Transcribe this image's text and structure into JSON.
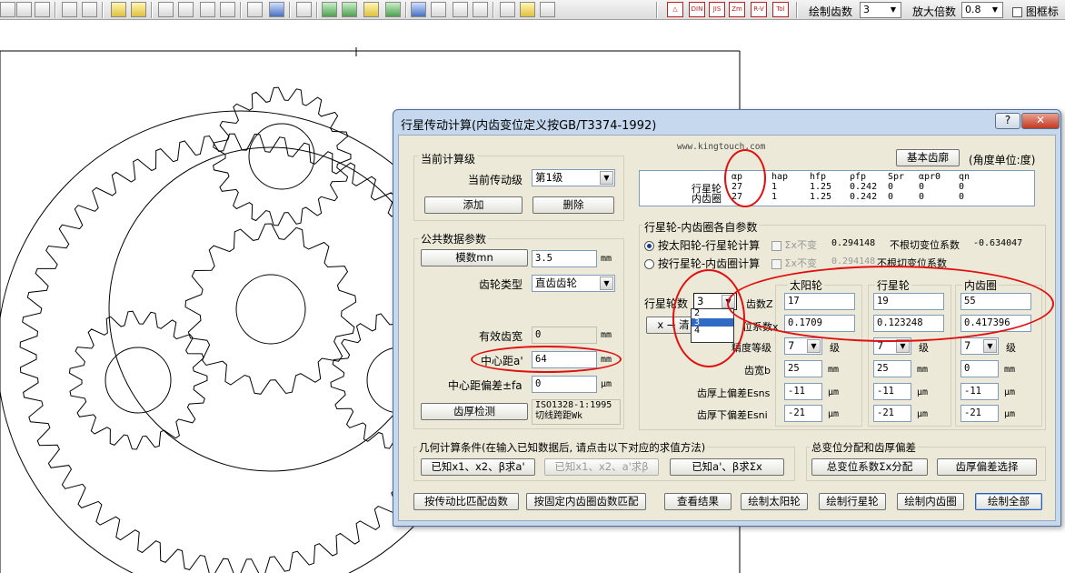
{
  "toolbar": {
    "teeth_label": "绘制齿数",
    "teeth_value": "3",
    "scale_label": "放大倍数",
    "scale_value": "0.8",
    "frame_label": "图框标",
    "icons": [
      "print-icon",
      "preview-icon",
      "copy-icon",
      "page-icon",
      "edit-icon",
      "zoom-in-icon",
      "zoom-out-icon",
      "zoom-fit-icon",
      "zoom-window-icon",
      "list-icon",
      "chart-icon",
      "window-icon",
      "save-icon",
      "open-icon",
      "export-icon",
      "import-icon",
      "display-icon",
      "tool-icon",
      "gear-icon",
      "help-cursor-icon",
      "info-icon",
      "doc-icon"
    ],
    "red_buttons": [
      "",
      "DIN",
      "JIS",
      "Zm",
      "R-V",
      "Tol"
    ]
  },
  "dialog": {
    "title": "行星传动计算(内齿变位定义按GB/T3374-1992)",
    "help_btn": "?",
    "close_btn": "✕",
    "watermark": "www.kingtouch.com",
    "current_stage": {
      "group_label": "当前计算级",
      "stage_label": "当前传动级",
      "stage_value": "第1级",
      "add_btn": "添加",
      "delete_btn": "删除"
    },
    "basic_rack_btn": "基本齿廓",
    "angle_unit": "(角度单位:度)",
    "rack_table": {
      "headers": [
        "αp",
        "hap",
        "hfp",
        "ρfp",
        "Spr",
        "αpr0",
        "qn"
      ],
      "rows": [
        {
          "name": "行星轮",
          "values": [
            "27",
            "1",
            "1.25",
            "0.242",
            "0",
            "0",
            "0"
          ]
        },
        {
          "name": "内齿圈",
          "values": [
            "27",
            "1",
            "1.25",
            "0.242",
            "0",
            "0",
            "0"
          ]
        }
      ]
    },
    "common": {
      "group_label": "公共数据参数",
      "module_btn": "模数mn",
      "module_value": "3.5",
      "module_unit": "mm",
      "gear_type_label": "齿轮类型",
      "gear_type_value": "直齿齿轮",
      "eff_width_label": "有效齿宽",
      "eff_width_value": "0",
      "eff_width_unit": "mm",
      "center_dist_label": "中心距a'",
      "center_dist_value": "64",
      "center_dist_unit": "mm",
      "center_dev_label": "中心距偏差±fa",
      "center_dev_value": "0",
      "center_dev_unit": "μm",
      "thickness_btn": "齿厚检测",
      "thickness_value_1": "ISO1328-1:1995",
      "thickness_value_2": "切线跨距Wk"
    },
    "planet": {
      "group_label": "行星轮-内齿圈各自参数",
      "radio1": "按太阳轮-行星轮计算",
      "radio2": "按行星轮-内齿圈计算",
      "sigma_label": "Σx不变",
      "sigma1_value": "0.294148",
      "sigma2_value": "0.294148",
      "nocut1_label": "不根切变位系数",
      "nocut1_value": "-0.634047",
      "nocut2_label": "不根切变位系数",
      "planet_count_label": "行星轮数",
      "planet_count_value": "3",
      "dropdown_options": [
        "2",
        "3",
        "4"
      ],
      "x_clear_btn": "x → 清",
      "col_headers": [
        "太阳轮",
        "行星轮",
        "内齿圈"
      ],
      "teeth_label": "齿数Z",
      "teeth_values": [
        "17",
        "19",
        "55"
      ],
      "shift_label": "位系数x",
      "shift_values": [
        "0.1709",
        "0.123248",
        "0.417396"
      ],
      "grade_label": "精度等级",
      "grade_values": [
        "7",
        "7",
        "7"
      ],
      "grade_unit": "级",
      "width_label": "齿宽b",
      "width_values": [
        "25",
        "25",
        "0"
      ],
      "width_unit": "mm",
      "upper_label": "齿厚上偏差Esns",
      "upper_values": [
        "-11",
        "-11",
        "-11"
      ],
      "lower_label": "齿厚下偏差Esni",
      "lower_values": [
        "-21",
        "-21",
        "-21"
      ],
      "micron_unit": "μm"
    },
    "geometry": {
      "group_label": "几何计算条件(在输入已知数据后, 请点击以下对应的求值方法)",
      "btn1": "已知x1、x2、β求a'",
      "btn2": "已知x1、x2、a'求β",
      "btn3": "已知a'、β求Σx"
    },
    "total_shift": {
      "group_label": "总变位分配和齿厚偏差",
      "btn1": "总变位系数Σx分配",
      "btn2": "齿厚偏差选择"
    },
    "bottom_buttons": [
      "按传动比匹配齿数",
      "按固定内齿圈齿数匹配",
      "查看结果",
      "绘制太阳轮",
      "绘制行星轮",
      "绘制内齿圈",
      "绘制全部"
    ]
  }
}
